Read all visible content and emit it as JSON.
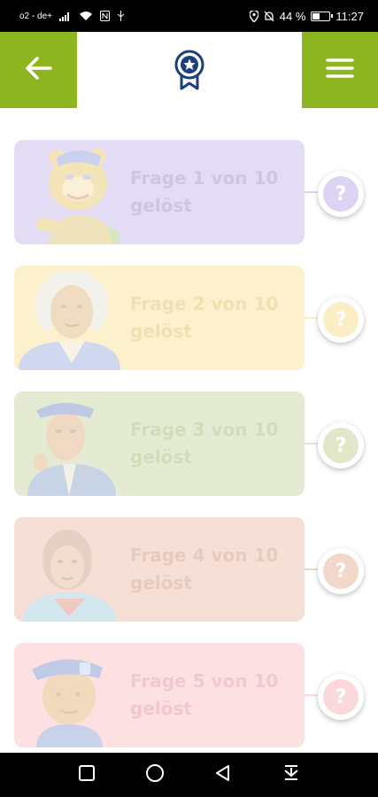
{
  "status_bar": {
    "carrier": "o2 - de+",
    "battery_percent": "44 %",
    "battery_level": 0.44,
    "time": "11:27"
  },
  "header": {
    "back_icon": "arrow-left-icon",
    "logo_icon": "award-ribbon-icon",
    "menu_icon": "hamburger-menu-icon",
    "accent_color": "#8db51f",
    "logo_color": "#1c3f7a"
  },
  "quiz_items": [
    {
      "label_line1": "Frage 1 von 10",
      "label_line2": "gelöst",
      "badge": "?",
      "card_color": "#e4dcf5",
      "text_color": "#cfc6e6",
      "badge_color": "#ddd3f3"
    },
    {
      "label_line1": "Frage 2 von 10",
      "label_line2": "gelöst",
      "badge": "?",
      "card_color": "#fdf1cd",
      "text_color": "#f0e1b2",
      "badge_color": "#fceec4"
    },
    {
      "label_line1": "Frage 3 von 10",
      "label_line2": "gelöst",
      "badge": "?",
      "card_color": "#e5ebd2",
      "text_color": "#d3dcb9",
      "badge_color": "#e1e8c9"
    },
    {
      "label_line1": "Frage 4 von 10",
      "label_line2": "gelöst",
      "badge": "?",
      "card_color": "#f5dfd6",
      "text_color": "#e8cbbd",
      "badge_color": "#f2d7cb"
    },
    {
      "label_line1": "Frage 5 von 10",
      "label_line2": "gelöst",
      "badge": "?",
      "card_color": "#fde0e1",
      "text_color": "#f1c9cb",
      "badge_color": "#fbd9da"
    }
  ],
  "nav_bar": {
    "recents_icon": "square-icon",
    "home_icon": "circle-icon",
    "back_icon": "triangle-back-icon",
    "notifications_icon": "pull-down-icon"
  }
}
